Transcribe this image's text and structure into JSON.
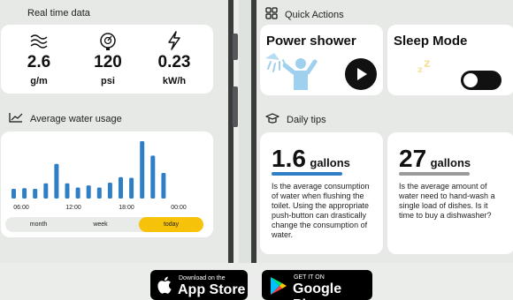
{
  "realtime": {
    "title": "Real time data",
    "items": [
      {
        "icon": "water-waves-icon",
        "value": "2.6",
        "unit": "g/m"
      },
      {
        "icon": "pressure-gauge-icon",
        "value": "120",
        "unit": "psi"
      },
      {
        "icon": "lightning-bolt-icon",
        "value": "0.23",
        "unit": "kW/h"
      }
    ]
  },
  "usage": {
    "title": "Average water usage",
    "icon": "line-chart-icon",
    "range_options": [
      "month",
      "week",
      "today"
    ],
    "selected_range": "today"
  },
  "chart_data": {
    "type": "bar",
    "values": [
      14,
      15,
      14,
      22,
      50,
      22,
      16,
      19,
      16,
      23,
      31,
      30,
      83,
      62,
      37
    ],
    "x_tick_labels": [
      "06:00",
      "12:00",
      "18:00",
      "00:00"
    ],
    "color": "#2f7fc7"
  },
  "quick_actions": {
    "title": "Quick Actions",
    "icon": "grid-icon",
    "power_shower": {
      "label": "Power shower",
      "icon": "shower-person-icon",
      "button_icon": "play-icon"
    },
    "sleep_mode": {
      "label": "Sleep Mode",
      "icon": "moon-zzz-icon",
      "enabled": false
    }
  },
  "tips": {
    "title": "Daily tips",
    "icon": "graduation-cap-icon",
    "cards": [
      {
        "number": "1.6",
        "unit": "gallons",
        "line_color": "#2f7fc7",
        "text": "Is the average consumption of water when flushing the toilet. Using the appropriate push-button can drastically change the consumption of water."
      },
      {
        "number": "27",
        "unit": "gallons",
        "line_color": "#9a9a9a",
        "text": "Is the average amount of water need to hand-wash a single load of dishes. Is it time to buy a dishwasher?"
      }
    ]
  },
  "stores": {
    "apple": {
      "small": "Download on the",
      "big": "App Store"
    },
    "google": {
      "small": "GET IT ON",
      "big": "Google Play"
    }
  }
}
